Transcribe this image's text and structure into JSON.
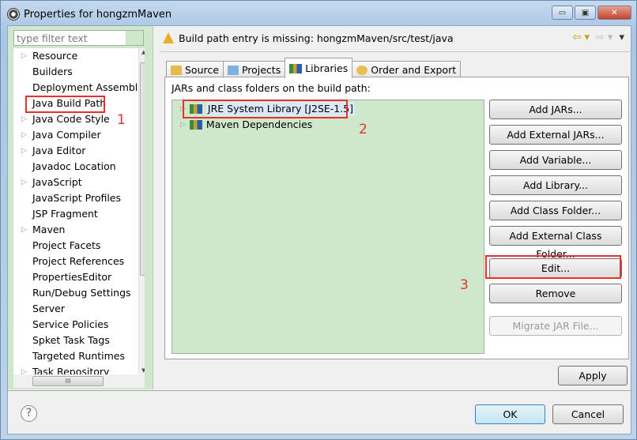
{
  "window": {
    "title": "Properties for hongzmMaven"
  },
  "filter": {
    "placeholder": "type filter text"
  },
  "sidebar": {
    "items": [
      {
        "label": "Resource",
        "expandable": true
      },
      {
        "label": "Builders",
        "expandable": false
      },
      {
        "label": "Deployment Assembly",
        "expandable": false
      },
      {
        "label": "Java Build Path",
        "expandable": false,
        "selected": true
      },
      {
        "label": "Java Code Style",
        "expandable": true
      },
      {
        "label": "Java Compiler",
        "expandable": true
      },
      {
        "label": "Java Editor",
        "expandable": true
      },
      {
        "label": "Javadoc Location",
        "expandable": false
      },
      {
        "label": "JavaScript",
        "expandable": true
      },
      {
        "label": "JavaScript Profiles",
        "expandable": false
      },
      {
        "label": "JSP Fragment",
        "expandable": false
      },
      {
        "label": "Maven",
        "expandable": true
      },
      {
        "label": "Project Facets",
        "expandable": false
      },
      {
        "label": "Project References",
        "expandable": false
      },
      {
        "label": "PropertiesEditor",
        "expandable": false
      },
      {
        "label": "Run/Debug Settings",
        "expandable": false
      },
      {
        "label": "Server",
        "expandable": false
      },
      {
        "label": "Service Policies",
        "expandable": false
      },
      {
        "label": "Spket Task Tags",
        "expandable": false
      },
      {
        "label": "Targeted Runtimes",
        "expandable": false
      },
      {
        "label": "Task Repository",
        "expandable": true
      }
    ]
  },
  "message": "Build path entry is missing: hongzmMaven/src/test/java",
  "tabs": [
    {
      "label": "Source"
    },
    {
      "label": "Projects"
    },
    {
      "label": "Libraries",
      "active": true
    },
    {
      "label": "Order and Export"
    }
  ],
  "panel": {
    "label": "JARs and class folders on the build path:",
    "entries": [
      {
        "label": "JRE System Library [J2SE-1.5]"
      },
      {
        "label": "Maven Dependencies"
      }
    ]
  },
  "buttons": {
    "add_jars": "Add JARs...",
    "add_external_jars": "Add External JARs...",
    "add_variable": "Add Variable...",
    "add_library": "Add Library...",
    "add_class_folder": "Add Class Folder...",
    "add_external_class_folder": "Add External Class Folder...",
    "edit": "Edit...",
    "remove": "Remove",
    "migrate": "Migrate JAR File...",
    "apply": "Apply",
    "ok": "OK",
    "cancel": "Cancel"
  },
  "annotations": {
    "one": "1",
    "two": "2",
    "three": "3",
    "color": "#e8302c"
  }
}
